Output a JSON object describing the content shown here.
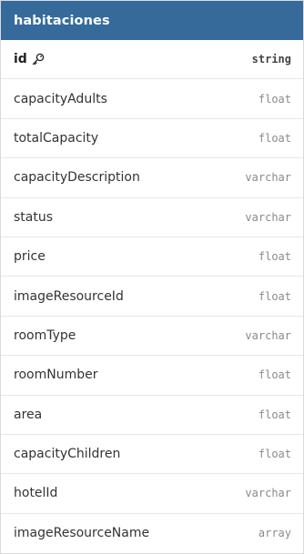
{
  "table": {
    "title": "habitaciones",
    "header_color": "#356a9b",
    "fields": [
      {
        "name": "id",
        "type": "string",
        "primary_key": true,
        "icon": "key-icon"
      },
      {
        "name": "capacityAdults",
        "type": "float"
      },
      {
        "name": "totalCapacity",
        "type": "float"
      },
      {
        "name": "capacityDescription",
        "type": "varchar"
      },
      {
        "name": "status",
        "type": "varchar"
      },
      {
        "name": "price",
        "type": "float"
      },
      {
        "name": "imageResourceId",
        "type": "float"
      },
      {
        "name": "roomType",
        "type": "varchar"
      },
      {
        "name": "roomNumber",
        "type": "float"
      },
      {
        "name": "area",
        "type": "float"
      },
      {
        "name": "capacityChildren",
        "type": "float"
      },
      {
        "name": "hotelId",
        "type": "varchar"
      },
      {
        "name": "imageResourceName",
        "type": "array"
      }
    ]
  }
}
